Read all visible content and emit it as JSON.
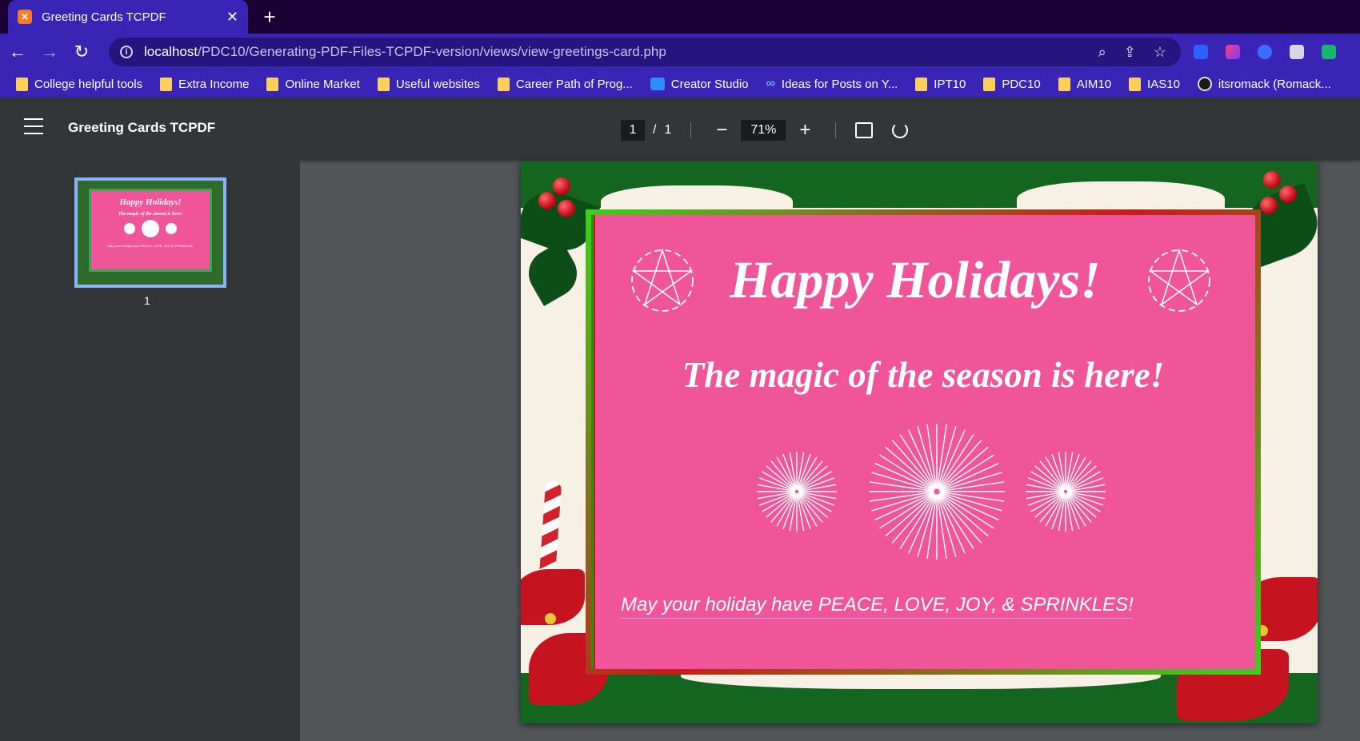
{
  "browser": {
    "tab_title": "Greeting Cards TCPDF",
    "tab_favicon_icon": "xampp-icon",
    "url_host": "localhost",
    "url_path": "/PDC10/Generating-PDF-Files-TCPDF-version/views/view-greetings-card.php",
    "theme_color": "#3a24b5"
  },
  "bookmarks": [
    {
      "label": "College helpful tools",
      "icon": "folder-icon"
    },
    {
      "label": "Extra Income",
      "icon": "folder-icon"
    },
    {
      "label": "Online Market",
      "icon": "folder-icon"
    },
    {
      "label": "Useful websites",
      "icon": "folder-icon"
    },
    {
      "label": "Career Path of Prog...",
      "icon": "folder-icon"
    },
    {
      "label": "Creator Studio",
      "icon": "creator-studio-icon"
    },
    {
      "label": "Ideas for Posts on Y...",
      "icon": "meta-icon"
    },
    {
      "label": "IPT10",
      "icon": "folder-icon"
    },
    {
      "label": "PDC10",
      "icon": "folder-icon"
    },
    {
      "label": "AIM10",
      "icon": "folder-icon"
    },
    {
      "label": "IAS10",
      "icon": "folder-icon"
    },
    {
      "label": "itsromack (Romack...",
      "icon": "github-icon"
    }
  ],
  "pdf_viewer": {
    "title": "Greeting Cards TCPDF",
    "current_page": "1",
    "page_separator": "/",
    "total_pages": "1",
    "zoom": "71%",
    "thumbnail_label": "1"
  },
  "card": {
    "title": "Happy Holidays!",
    "subtitle": "The magic of the season is here!",
    "footer": "May your holiday have PEACE, LOVE, JOY, & SPRINKLES!",
    "background_color": "#f0559a",
    "frame_colors": [
      "#3ad11c",
      "#c71c1c"
    ]
  }
}
